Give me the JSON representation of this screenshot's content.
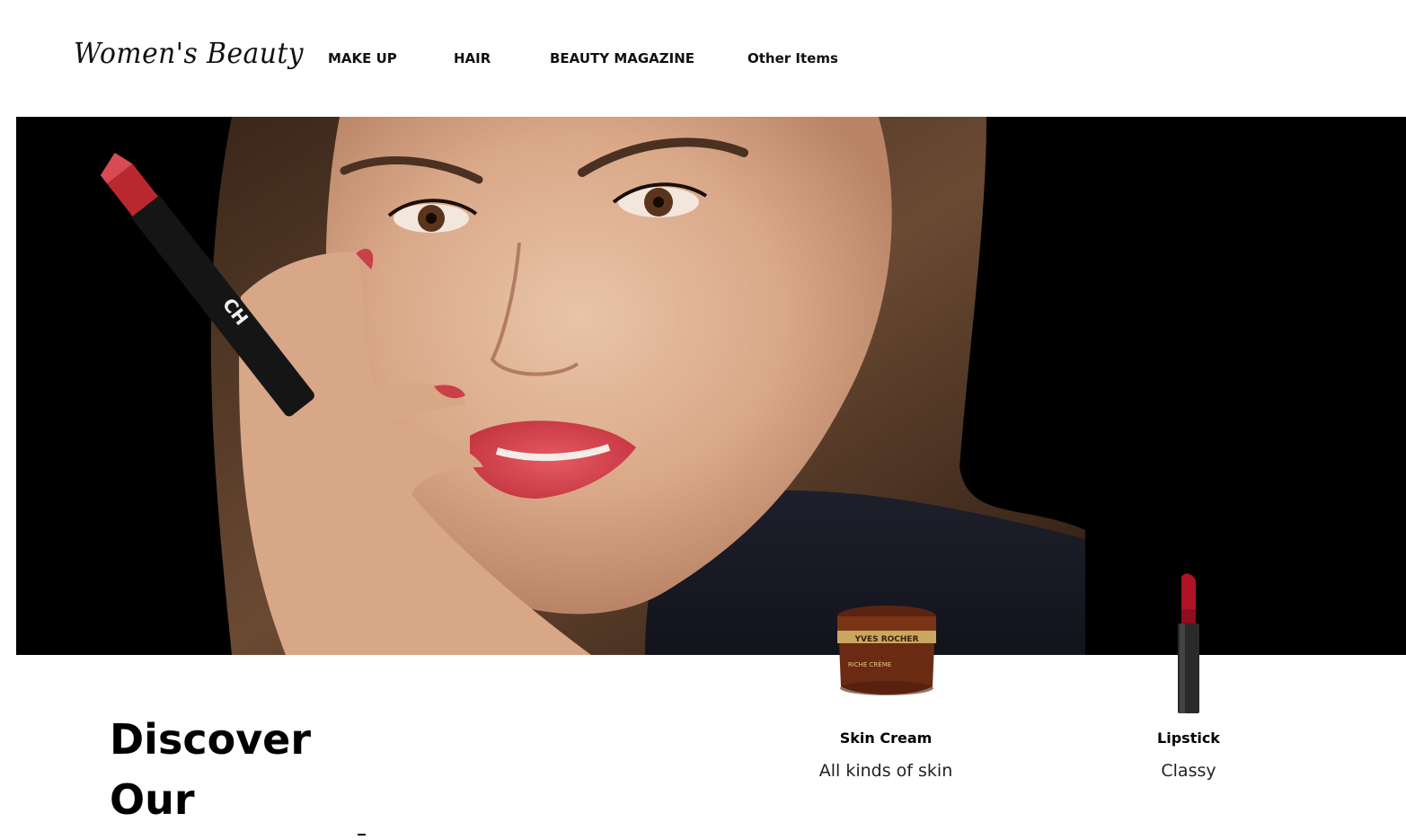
{
  "brand": {
    "logo_text": "Women's Beauty"
  },
  "nav": {
    "items": [
      {
        "label": "MAKE UP"
      },
      {
        "label": "HAIR"
      },
      {
        "label": "BEAUTY MAGAZINE"
      },
      {
        "label": "Other Items"
      }
    ]
  },
  "hero": {
    "image": "model-with-lipstick-photo",
    "lipstick_brand_text": "CH"
  },
  "discover": {
    "line1": "Discover",
    "line2": "Our"
  },
  "products": [
    {
      "name": "Skin Cream",
      "description": "All kinds of skin",
      "icon": "skin-cream-jar-icon",
      "jar_label": "YVES ROCHER",
      "jar_sublabel": "RICHE CRÈME"
    },
    {
      "name": "Lipstick",
      "description": "Classy",
      "icon": "lipstick-icon"
    }
  ],
  "colors": {
    "hero_background": "#000000",
    "lip_red": "#d9404a",
    "lipstick_red": "#b01226",
    "cream_brown": "#6b2a12",
    "cream_gold": "#c9a760"
  }
}
